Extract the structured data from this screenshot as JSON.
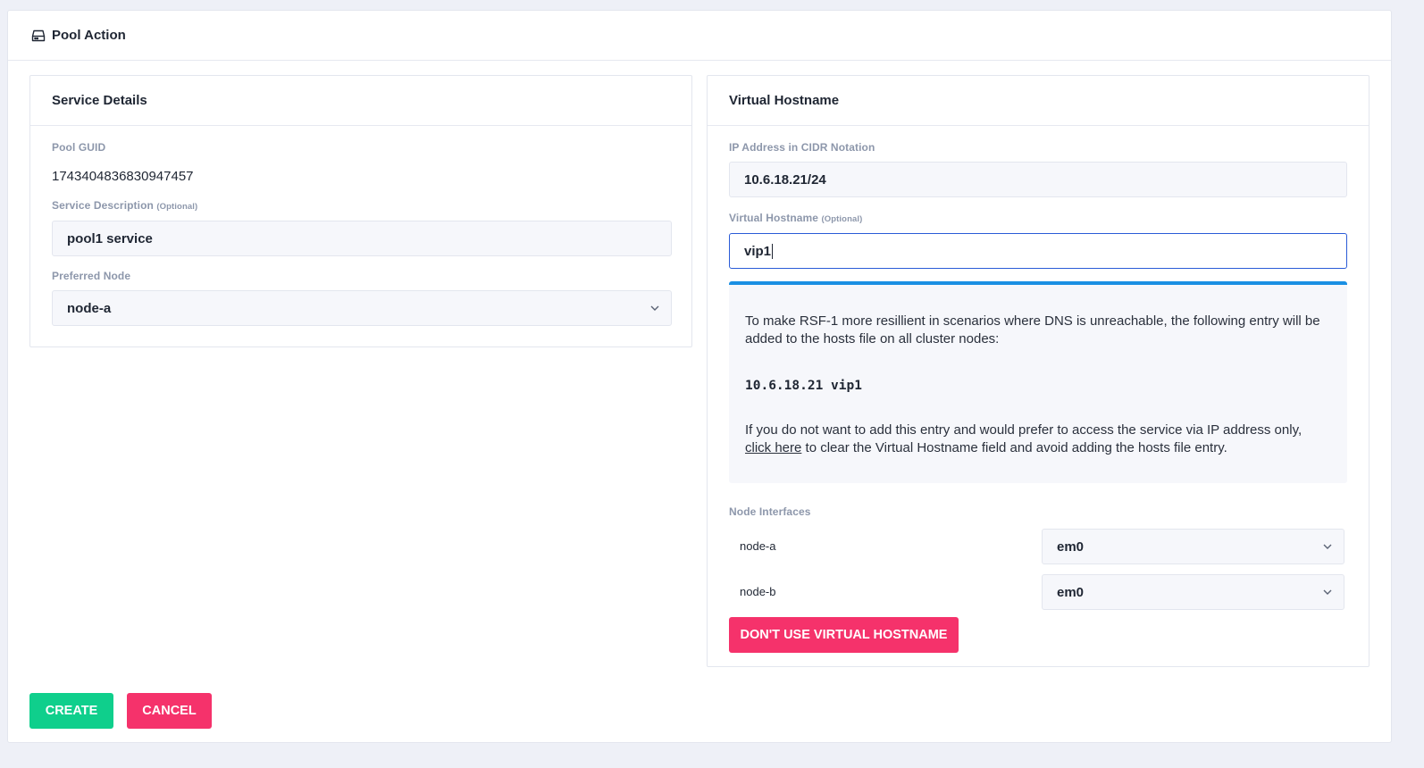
{
  "header": {
    "title": "Pool Action"
  },
  "service_details": {
    "title": "Service Details",
    "pool_guid_label": "Pool GUID",
    "pool_guid_value": "1743404836830947457",
    "description_label": "Service Description",
    "description_optional": "(Optional)",
    "description_value": "pool1 service",
    "preferred_node_label": "Preferred Node",
    "preferred_node_value": "node-a"
  },
  "virtual_hostname": {
    "title": "Virtual Hostname",
    "ip_label": "IP Address in CIDR Notation",
    "ip_value": "10.6.18.21/24",
    "hostname_label": "Virtual Hostname",
    "hostname_optional": "(Optional)",
    "hostname_value": "vip1",
    "notice": {
      "text1": "To make RSF-1 more resillient in scenarios where DNS is unreachable, the following entry will be added to the hosts file on all cluster nodes:",
      "hosts_entry": "10.6.18.21 vip1",
      "text2_before": "If you do not want to add this entry and would prefer to access the service via IP address only, ",
      "link": "click here",
      "text2_after": " to clear the Virtual Hostname field and avoid adding the hosts file entry."
    },
    "interfaces_label": "Node Interfaces",
    "interfaces": [
      {
        "node": "node-a",
        "interface": "em0"
      },
      {
        "node": "node-b",
        "interface": "em0"
      }
    ],
    "dont_use_label": "DON'T USE VIRTUAL HOSTNAME"
  },
  "actions": {
    "create_label": "CREATE",
    "cancel_label": "CANCEL"
  },
  "colors": {
    "accent_blue": "#1a8fe3",
    "focus_blue": "#2a5bd7",
    "danger_pink": "#f5326b",
    "success_green": "#0fcf8c"
  }
}
